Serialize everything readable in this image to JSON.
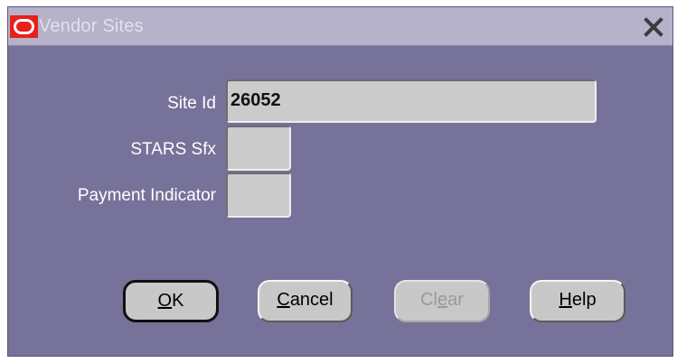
{
  "window": {
    "title": "Vendor Sites"
  },
  "fields": {
    "site_id": {
      "label": "Site Id",
      "value": "26052"
    },
    "stars_sfx": {
      "label": "STARS Sfx",
      "value": ""
    },
    "payment_indicator": {
      "label": "Payment Indicator",
      "value": ""
    }
  },
  "buttons": {
    "ok": {
      "mnemonic": "O",
      "rest": "K"
    },
    "cancel": {
      "mnemonic": "C",
      "rest": "ancel"
    },
    "clear": {
      "pre": "Cl",
      "mnemonic": "e",
      "rest": "ar"
    },
    "help": {
      "mnemonic": "H",
      "rest": "elp"
    }
  },
  "icons": {
    "app": "oracle-logo-icon",
    "close": "close-icon"
  },
  "colors": {
    "window_bg": "#76729a",
    "titlebar_bg": "#b5b2c9",
    "field_bg": "#cbcbcb",
    "button_bg": "#c8c8c8",
    "oracle_red": "#e8201b"
  }
}
